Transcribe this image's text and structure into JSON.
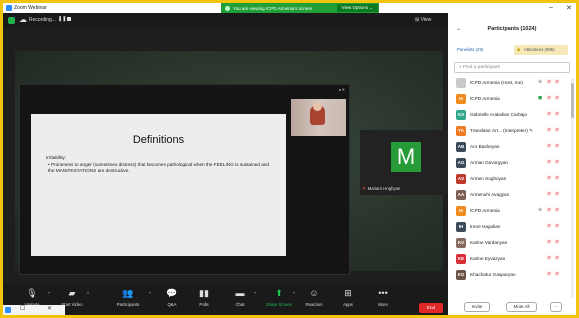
{
  "window": {
    "app_title": "Zoom Webinar",
    "minimize": "–",
    "close": "✕"
  },
  "share_banner": {
    "message": "You are viewing ICPD Armenia's screen",
    "view_options": "View Options ⌄"
  },
  "recording": {
    "label": "Recording...",
    "pause": "❚❚",
    "cloud_icon": "cloud-icon"
  },
  "view_button": "⊞ View",
  "slide": {
    "title": "Definitions",
    "heading": "Irritability:",
    "body": "• Proneness to anger (sometimes distress) that becomes pathological when the FEELING is sustained and the MANIFESTATIONS are destructive."
  },
  "video_tile": {
    "initial": "M",
    "name": "Mariam Hnghyan"
  },
  "toolbar": {
    "items": [
      {
        "label": "Unmute",
        "icon": "mic-icon",
        "glyph": "🎙"
      },
      {
        "label": "Start Video",
        "icon": "video-icon",
        "glyph": "▰"
      },
      {
        "label": "Participants",
        "icon": "participants-icon",
        "glyph": "👥",
        "badge": "1k"
      },
      {
        "label": "Q&A",
        "icon": "qa-icon",
        "glyph": "💬"
      },
      {
        "label": "Polls",
        "icon": "polls-icon",
        "glyph": "▮▮"
      },
      {
        "label": "Chat",
        "icon": "chat-icon",
        "glyph": "▬"
      },
      {
        "label": "Share Screen",
        "icon": "share-screen-icon",
        "glyph": "⬆"
      },
      {
        "label": "Reaction",
        "icon": "reaction-icon",
        "glyph": "☺"
      },
      {
        "label": "Apps",
        "icon": "apps-icon",
        "glyph": "⊞"
      },
      {
        "label": "More",
        "icon": "more-icon",
        "glyph": "•••"
      }
    ],
    "end_label": "End"
  },
  "participants": {
    "header": "Participants (1024)",
    "tabs": {
      "panelists": "Panelists (29)",
      "attendees": "Attendees (995)"
    },
    "search_placeholder": "Find a participant",
    "rows": [
      {
        "name": "ICPD Armenia (Host, me)",
        "initials": "",
        "color": "#c9c9c9",
        "extra": "⊕"
      },
      {
        "name": "ICPD Armenia",
        "initials": "IA",
        "color": "#f08c1e",
        "extra": "◼"
      },
      {
        "name": "Gabrielle Arakelian Carbajo",
        "initials": "GA",
        "color": "#2fa88a",
        "extra": ""
      },
      {
        "name": "Translator Art... (Interpreter) ✎",
        "initials": "TA",
        "color": "#ef7b22",
        "extra": ""
      },
      {
        "name": "Aro Basheyan",
        "initials": "AB",
        "color": "#3c4a5c",
        "extra": ""
      },
      {
        "name": "Arman Gevorgyan",
        "initials": "AG",
        "color": "#3c4a5c",
        "extra": ""
      },
      {
        "name": "Armen Soghoyan",
        "initials": "AS",
        "color": "#c0392b",
        "extra": ""
      },
      {
        "name": "Armenuhi Avagyan",
        "initials": "AA",
        "color": "#7d5f56",
        "extra": ""
      },
      {
        "name": "ICPD Armenia",
        "initials": "IA",
        "color": "#f08c1e",
        "extra": "⊕"
      },
      {
        "name": "Irene Hagolian",
        "initials": "IH",
        "color": "#3c4a5c",
        "extra": ""
      },
      {
        "name": "Karine Vardanyan",
        "initials": "KV",
        "color": "#8a6b60",
        "extra": ""
      },
      {
        "name": "Karine Eyvazyan",
        "initials": "KE",
        "color": "#d62f3a",
        "extra": ""
      },
      {
        "name": "Khachatur Gasparyan",
        "initials": "KG",
        "color": "#6b5448",
        "extra": ""
      }
    ],
    "invite": "Invite",
    "mute_all": "Mute All",
    "more": "···"
  }
}
